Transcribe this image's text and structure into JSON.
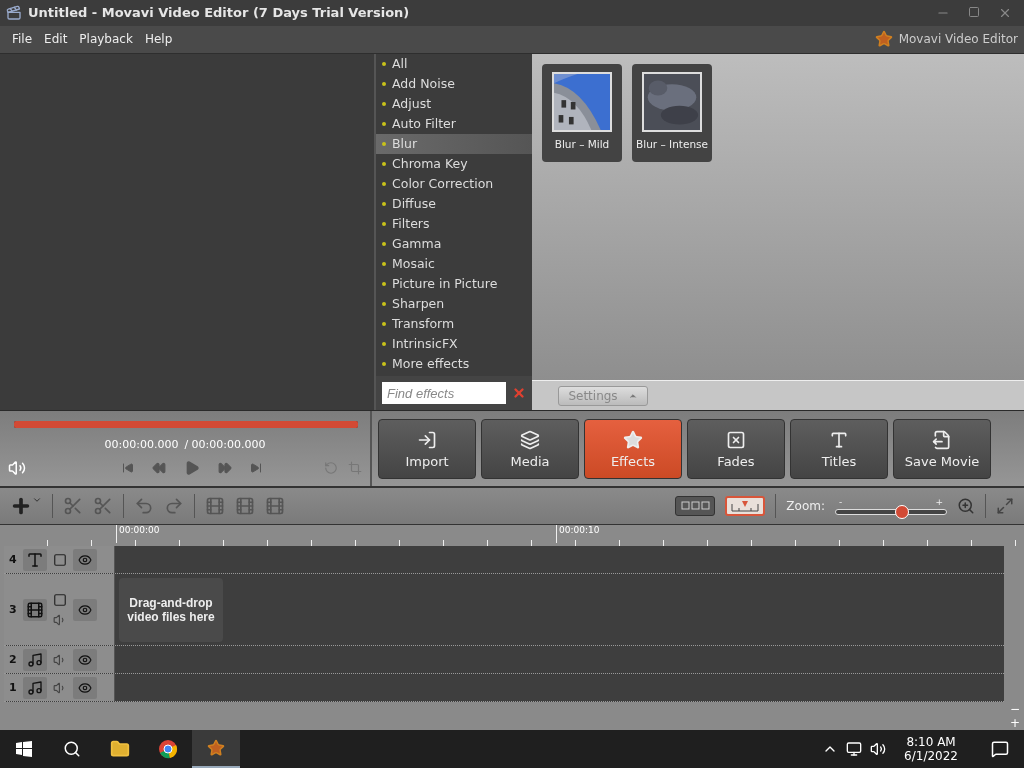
{
  "window": {
    "title": "Untitled - Movavi Video Editor (7 Days Trial Version)"
  },
  "menu": [
    "File",
    "Edit",
    "Playback",
    "Help"
  ],
  "brand": "Movavi Video Editor",
  "effect_categories": [
    {
      "label": "All",
      "selected": false
    },
    {
      "label": "Add Noise",
      "selected": false
    },
    {
      "label": "Adjust",
      "selected": false
    },
    {
      "label": "Auto Filter",
      "selected": false
    },
    {
      "label": "Blur",
      "selected": true
    },
    {
      "label": "Chroma Key",
      "selected": false
    },
    {
      "label": "Color Correction",
      "selected": false
    },
    {
      "label": "Diffuse",
      "selected": false
    },
    {
      "label": "Filters",
      "selected": false
    },
    {
      "label": "Gamma",
      "selected": false
    },
    {
      "label": "Mosaic",
      "selected": false
    },
    {
      "label": "Picture in Picture",
      "selected": false
    },
    {
      "label": "Sharpen",
      "selected": false
    },
    {
      "label": "Transform",
      "selected": false
    },
    {
      "label": "IntrinsicFX",
      "selected": false
    },
    {
      "label": "More effects",
      "selected": false
    }
  ],
  "search": {
    "placeholder": "Find effects"
  },
  "effects": [
    {
      "label": "Blur – Mild",
      "kind": "building"
    },
    {
      "label": "Blur – Intense",
      "kind": "haze"
    }
  ],
  "settings_button": "Settings",
  "progress": {
    "level": 1
  },
  "timecode": {
    "current": "00:00:00.000",
    "total": "/ 00:00:00.000"
  },
  "nav_buttons": [
    {
      "label": "Import",
      "kind": "import",
      "selected": false
    },
    {
      "label": "Media",
      "kind": "media",
      "selected": false
    },
    {
      "label": "Effects",
      "kind": "effects",
      "selected": true
    },
    {
      "label": "Fades",
      "kind": "fades",
      "selected": false
    },
    {
      "label": "Titles",
      "kind": "titles",
      "selected": false
    },
    {
      "label": "Save Movie",
      "kind": "save",
      "selected": false
    }
  ],
  "view_modes": [
    {
      "kind": "storyboard",
      "selected": false
    },
    {
      "kind": "timeline",
      "selected": true
    }
  ],
  "zoom": {
    "label": "Zoom:",
    "minus": "-",
    "plus": "+",
    "level": 0.6
  },
  "ruler": [
    "00:00:00",
    "00:00:10"
  ],
  "tracks": [
    {
      "number": "4",
      "kind": "title"
    },
    {
      "number": "3",
      "kind": "video",
      "hint": "Drag-and-drop video files here"
    },
    {
      "number": "2",
      "kind": "audio"
    },
    {
      "number": "1",
      "kind": "audio"
    }
  ],
  "timeline_controls": {
    "minus": "−",
    "plus": "+"
  },
  "taskbar": {
    "time": "8:10 AM",
    "date": "6/1/2022"
  }
}
